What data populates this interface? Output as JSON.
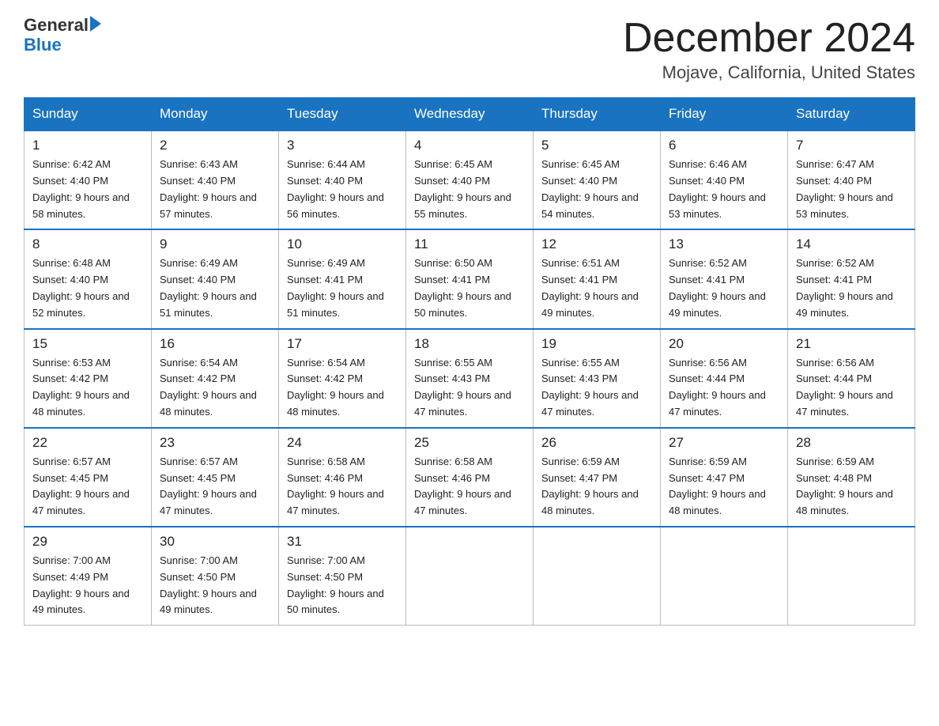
{
  "header": {
    "logo_line1": "General",
    "logo_line2": "Blue",
    "month_title": "December 2024",
    "location": "Mojave, California, United States"
  },
  "weekdays": [
    "Sunday",
    "Monday",
    "Tuesday",
    "Wednesday",
    "Thursday",
    "Friday",
    "Saturday"
  ],
  "weeks": [
    [
      {
        "date": "1",
        "sunrise": "6:42 AM",
        "sunset": "4:40 PM",
        "daylight": "9 hours and 58 minutes."
      },
      {
        "date": "2",
        "sunrise": "6:43 AM",
        "sunset": "4:40 PM",
        "daylight": "9 hours and 57 minutes."
      },
      {
        "date": "3",
        "sunrise": "6:44 AM",
        "sunset": "4:40 PM",
        "daylight": "9 hours and 56 minutes."
      },
      {
        "date": "4",
        "sunrise": "6:45 AM",
        "sunset": "4:40 PM",
        "daylight": "9 hours and 55 minutes."
      },
      {
        "date": "5",
        "sunrise": "6:45 AM",
        "sunset": "4:40 PM",
        "daylight": "9 hours and 54 minutes."
      },
      {
        "date": "6",
        "sunrise": "6:46 AM",
        "sunset": "4:40 PM",
        "daylight": "9 hours and 53 minutes."
      },
      {
        "date": "7",
        "sunrise": "6:47 AM",
        "sunset": "4:40 PM",
        "daylight": "9 hours and 53 minutes."
      }
    ],
    [
      {
        "date": "8",
        "sunrise": "6:48 AM",
        "sunset": "4:40 PM",
        "daylight": "9 hours and 52 minutes."
      },
      {
        "date": "9",
        "sunrise": "6:49 AM",
        "sunset": "4:40 PM",
        "daylight": "9 hours and 51 minutes."
      },
      {
        "date": "10",
        "sunrise": "6:49 AM",
        "sunset": "4:41 PM",
        "daylight": "9 hours and 51 minutes."
      },
      {
        "date": "11",
        "sunrise": "6:50 AM",
        "sunset": "4:41 PM",
        "daylight": "9 hours and 50 minutes."
      },
      {
        "date": "12",
        "sunrise": "6:51 AM",
        "sunset": "4:41 PM",
        "daylight": "9 hours and 49 minutes."
      },
      {
        "date": "13",
        "sunrise": "6:52 AM",
        "sunset": "4:41 PM",
        "daylight": "9 hours and 49 minutes."
      },
      {
        "date": "14",
        "sunrise": "6:52 AM",
        "sunset": "4:41 PM",
        "daylight": "9 hours and 49 minutes."
      }
    ],
    [
      {
        "date": "15",
        "sunrise": "6:53 AM",
        "sunset": "4:42 PM",
        "daylight": "9 hours and 48 minutes."
      },
      {
        "date": "16",
        "sunrise": "6:54 AM",
        "sunset": "4:42 PM",
        "daylight": "9 hours and 48 minutes."
      },
      {
        "date": "17",
        "sunrise": "6:54 AM",
        "sunset": "4:42 PM",
        "daylight": "9 hours and 48 minutes."
      },
      {
        "date": "18",
        "sunrise": "6:55 AM",
        "sunset": "4:43 PM",
        "daylight": "9 hours and 47 minutes."
      },
      {
        "date": "19",
        "sunrise": "6:55 AM",
        "sunset": "4:43 PM",
        "daylight": "9 hours and 47 minutes."
      },
      {
        "date": "20",
        "sunrise": "6:56 AM",
        "sunset": "4:44 PM",
        "daylight": "9 hours and 47 minutes."
      },
      {
        "date": "21",
        "sunrise": "6:56 AM",
        "sunset": "4:44 PM",
        "daylight": "9 hours and 47 minutes."
      }
    ],
    [
      {
        "date": "22",
        "sunrise": "6:57 AM",
        "sunset": "4:45 PM",
        "daylight": "9 hours and 47 minutes."
      },
      {
        "date": "23",
        "sunrise": "6:57 AM",
        "sunset": "4:45 PM",
        "daylight": "9 hours and 47 minutes."
      },
      {
        "date": "24",
        "sunrise": "6:58 AM",
        "sunset": "4:46 PM",
        "daylight": "9 hours and 47 minutes."
      },
      {
        "date": "25",
        "sunrise": "6:58 AM",
        "sunset": "4:46 PM",
        "daylight": "9 hours and 47 minutes."
      },
      {
        "date": "26",
        "sunrise": "6:59 AM",
        "sunset": "4:47 PM",
        "daylight": "9 hours and 48 minutes."
      },
      {
        "date": "27",
        "sunrise": "6:59 AM",
        "sunset": "4:47 PM",
        "daylight": "9 hours and 48 minutes."
      },
      {
        "date": "28",
        "sunrise": "6:59 AM",
        "sunset": "4:48 PM",
        "daylight": "9 hours and 48 minutes."
      }
    ],
    [
      {
        "date": "29",
        "sunrise": "7:00 AM",
        "sunset": "4:49 PM",
        "daylight": "9 hours and 49 minutes."
      },
      {
        "date": "30",
        "sunrise": "7:00 AM",
        "sunset": "4:50 PM",
        "daylight": "9 hours and 49 minutes."
      },
      {
        "date": "31",
        "sunrise": "7:00 AM",
        "sunset": "4:50 PM",
        "daylight": "9 hours and 50 minutes."
      },
      null,
      null,
      null,
      null
    ]
  ]
}
